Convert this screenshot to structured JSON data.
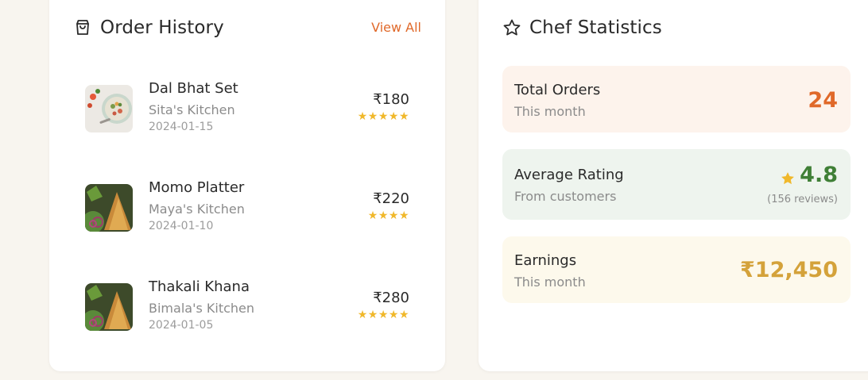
{
  "orders_card": {
    "title": "Order History",
    "view_all": "View All",
    "items": [
      {
        "name": "Dal Bhat Set",
        "kitchen": "Sita's Kitchen",
        "date": "2024-01-15",
        "price": "₹180",
        "rating": 5
      },
      {
        "name": "Momo Platter",
        "kitchen": "Maya's Kitchen",
        "date": "2024-01-10",
        "price": "₹220",
        "rating": 4
      },
      {
        "name": "Thakali Khana",
        "kitchen": "Bimala's Kitchen",
        "date": "2024-01-05",
        "price": "₹280",
        "rating": 5
      }
    ]
  },
  "stats_card": {
    "title": "Chef Statistics",
    "total_orders": {
      "label": "Total Orders",
      "sub": "This month",
      "value": "24",
      "color": "#e0692a",
      "bg": "#fdf3ec"
    },
    "average_rating": {
      "label": "Average Rating",
      "sub": "From customers",
      "value": "4.8",
      "note": "(156 reviews)",
      "color": "#3f7f36",
      "bg": "#eef4ee"
    },
    "earnings": {
      "label": "Earnings",
      "sub": "This month",
      "value": "₹12,450",
      "color": "#d4a23a",
      "bg": "#fdf9ec"
    }
  },
  "icons": {
    "orders_header": "shopping-bag-icon",
    "stats_header": "star-outline-icon",
    "rating": "star-filled-icon"
  },
  "colors": {
    "accent": "#e0692a",
    "star": "#f0b82b",
    "background": "#f8f5ef"
  }
}
